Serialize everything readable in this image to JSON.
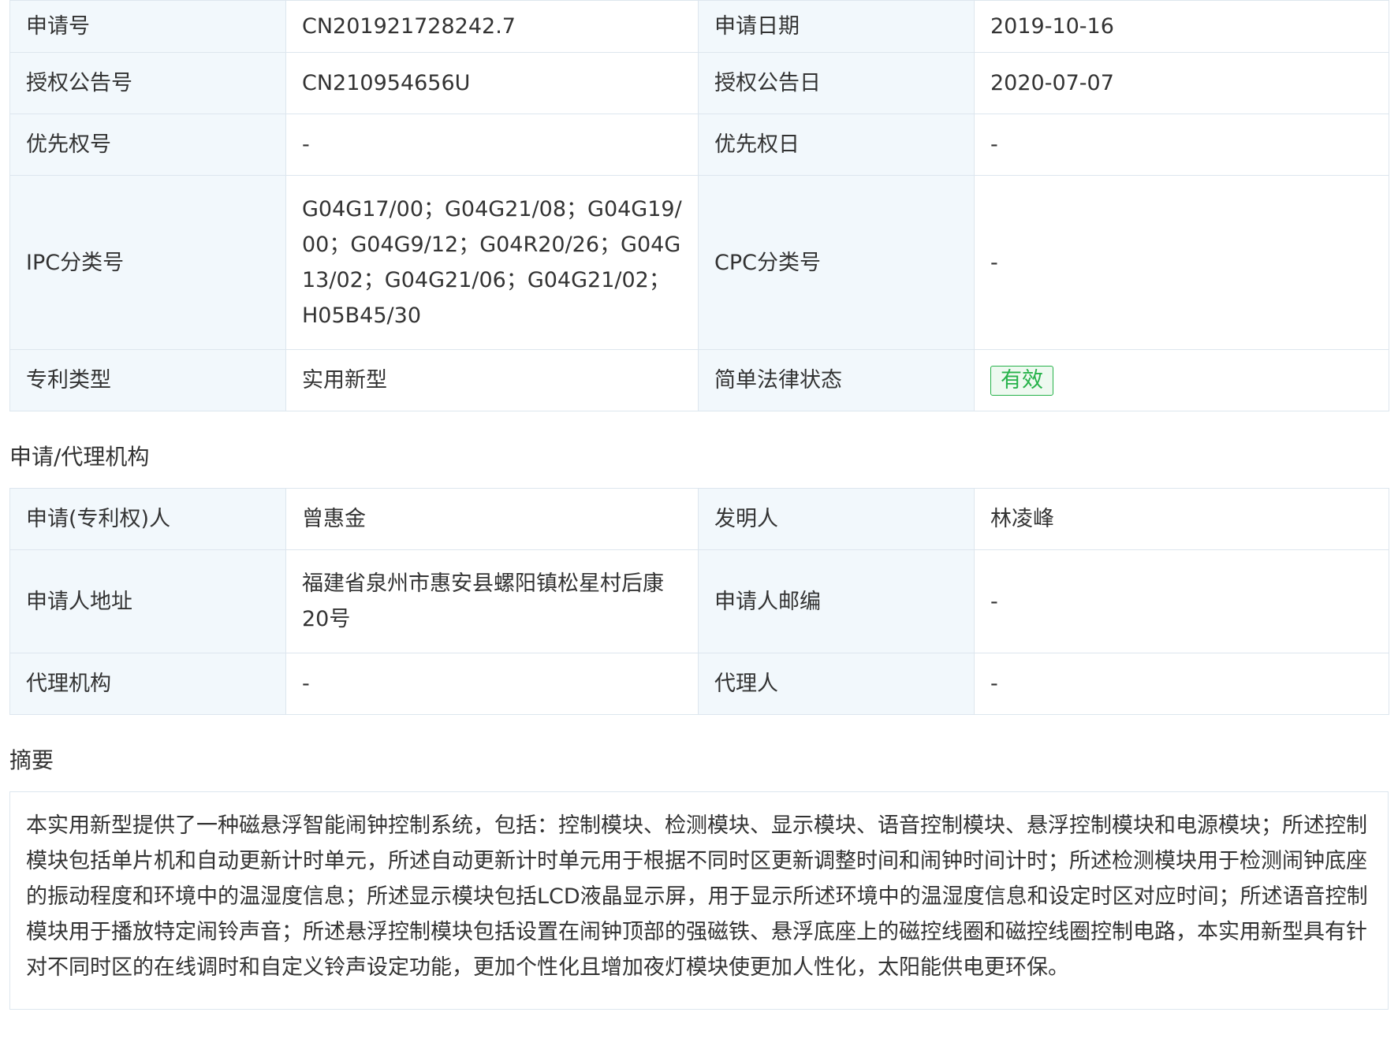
{
  "basic": {
    "rows": [
      {
        "l1": "申请号",
        "v1": "CN201921728242.7",
        "l2": "申请日期",
        "v2": "2019-10-16"
      },
      {
        "l1": "授权公告号",
        "v1": "CN210954656U",
        "l2": "授权公告日",
        "v2": "2020-07-07"
      },
      {
        "l1": "优先权号",
        "v1": "-",
        "l2": "优先权日",
        "v2": "-"
      },
      {
        "l1": "IPC分类号",
        "v1": "G04G17/00；G04G21/08；G04G19/00；G04G9/12；G04R20/26；G04G13/02；G04G21/06；G04G21/02；H05B45/30",
        "l2": "CPC分类号",
        "v2": "-"
      },
      {
        "l1": "专利类型",
        "v1": "实用新型",
        "l2": "简单法律状态",
        "v2": "有效"
      }
    ],
    "status_color": "#27b24a"
  },
  "agency": {
    "title": "申请/代理机构",
    "rows": [
      {
        "l1": "申请(专利权)人",
        "v1": "曾惠金",
        "l2": "发明人",
        "v2": "林凌峰"
      },
      {
        "l1": "申请人地址",
        "v1": "福建省泉州市惠安县螺阳镇松星村后康20号",
        "l2": "申请人邮编",
        "v2": "-"
      },
      {
        "l1": "代理机构",
        "v1": "-",
        "l2": "代理人",
        "v2": "-"
      }
    ]
  },
  "abstract": {
    "title": "摘要",
    "text": "本实用新型提供了一种磁悬浮智能闹钟控制系统，包括：控制模块、检测模块、显示模块、语音控制模块、悬浮控制模块和电源模块；所述控制模块包括单片机和自动更新计时单元，所述自动更新计时单元用于根据不同时区更新调整时间和闹钟时间计时；所述检测模块用于检测闹钟底座的振动程度和环境中的温湿度信息；所述显示模块包括LCD液晶显示屏，用于显示所述环境中的温湿度信息和设定时区对应时间；所述语音控制模块用于播放特定闹铃声音；所述悬浮控制模块包括设置在闹钟顶部的强磁铁、悬浮底座上的磁控线圈和磁控线圈控制电路，本实用新型具有针对不同时区的在线调时和自定义铃声设定功能，更加个性化且增加夜灯模块使更加人性化，太阳能供电更环保。"
  }
}
